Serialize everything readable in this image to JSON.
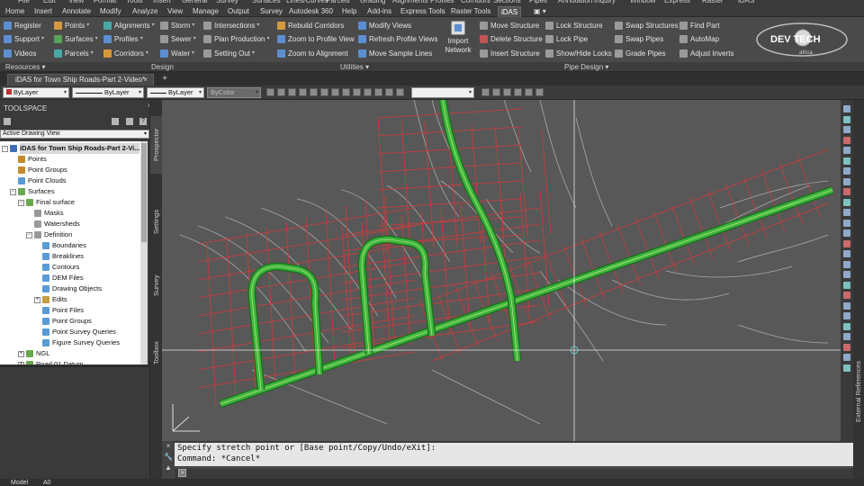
{
  "top_menu": [
    "File",
    "Edit",
    "View",
    "Format",
    "Tools",
    "Insert",
    "General",
    "Survey",
    "Surfaces",
    "Lines/Curves",
    "Parcels",
    "Grading",
    "Alignments",
    "Profiles",
    "Corridors",
    "Sections",
    "Pipes",
    "Annotation",
    "Inquiry",
    "Window",
    "Express",
    "Raster",
    "iDAS"
  ],
  "ribbon_tabs": [
    {
      "label": "Home"
    },
    {
      "label": "Insert"
    },
    {
      "label": "Annotate"
    },
    {
      "label": "Modify"
    },
    {
      "label": "Analyze"
    },
    {
      "label": "View"
    },
    {
      "label": "Manage"
    },
    {
      "label": "Output"
    },
    {
      "label": "Survey"
    },
    {
      "label": "Autodesk 360"
    },
    {
      "label": "Help"
    },
    {
      "label": "Add-ins"
    },
    {
      "label": "Express Tools"
    },
    {
      "label": "Raster Tools"
    },
    {
      "label": "iDAS",
      "active": true
    },
    {
      "label": "▣ ▾"
    }
  ],
  "ribbon": {
    "resources": [
      "Register",
      "Support",
      "Videos"
    ],
    "design_col1": [
      "Points",
      "Surfaces",
      "Parcels"
    ],
    "design_col2": [
      "Alignments",
      "Profiles",
      "Corridors"
    ],
    "design_col3": [
      "Storm",
      "Sewer",
      "Water"
    ],
    "design_col4": [
      "Intersections",
      "Plan Production",
      "Setting Out"
    ],
    "utilities_col1": [
      "Rebuild Corridors",
      "Zoom to Profile View",
      "Zoom to Alignment"
    ],
    "utilities_col2": [
      "Modify Views",
      "Refresh Profile Views",
      "Move Sample Lines"
    ],
    "import_network": "Import Network",
    "pipe_col1": [
      "Move Structure",
      "Delete Structure",
      "Insert Structure"
    ],
    "pipe_col2": [
      "Lock Structure",
      "Lock Pipe",
      "Show/Hide Locks"
    ],
    "pipe_col3": [
      "Swap Structures",
      "Swap Pipes",
      "Grade Pipes"
    ],
    "pipe_col4": [
      "Find Part",
      "AutoMap",
      "Adjust Inverts"
    ],
    "panels": {
      "resources": "Resources",
      "design": "Design",
      "utilities": "Utilities",
      "pipe_design": "Pipe Design"
    },
    "logo_text": "DEV TECH",
    "logo_sub": "africa"
  },
  "file_tab": {
    "title": "iDAS for Town Ship Roads-Part 2-Video*",
    "close": "×",
    "new": "+"
  },
  "properties": {
    "layer": "ByLayer",
    "linetype": "ByLayer",
    "lineweight": "ByLayer",
    "color": "ByColor",
    "arrow": "▾"
  },
  "toolspace": {
    "title": "TOOLSPACE",
    "close": "×",
    "view_select": "Active Drawing View",
    "tree": [
      {
        "label": "iDAS for Town Ship Roads-Part 2-Vi...",
        "level": 0,
        "toggle": "−",
        "bold": true
      },
      {
        "label": "Points",
        "level": 1,
        "toggle": ""
      },
      {
        "label": "Point Groups",
        "level": 1,
        "toggle": ""
      },
      {
        "label": "Point Clouds",
        "level": 1,
        "toggle": ""
      },
      {
        "label": "Surfaces",
        "level": 1,
        "toggle": "−"
      },
      {
        "label": "Final surface",
        "level": 2,
        "toggle": "−"
      },
      {
        "label": "Masks",
        "level": 3,
        "toggle": ""
      },
      {
        "label": "Watersheds",
        "level": 3,
        "toggle": ""
      },
      {
        "label": "Definition",
        "level": 3,
        "toggle": "−"
      },
      {
        "label": "Boundaries",
        "level": 4,
        "toggle": ""
      },
      {
        "label": "Breaklines",
        "level": 4,
        "toggle": ""
      },
      {
        "label": "Contours",
        "level": 4,
        "toggle": ""
      },
      {
        "label": "DEM Files",
        "level": 4,
        "toggle": ""
      },
      {
        "label": "Drawing Objects",
        "level": 4,
        "toggle": ""
      },
      {
        "label": "Edits",
        "level": 4,
        "toggle": "+"
      },
      {
        "label": "Point Files",
        "level": 4,
        "toggle": ""
      },
      {
        "label": "Point Groups",
        "level": 4,
        "toggle": ""
      },
      {
        "label": "Point Survey Queries",
        "level": 4,
        "toggle": ""
      },
      {
        "label": "Figure Survey Queries",
        "level": 4,
        "toggle": ""
      },
      {
        "label": "NGL",
        "level": 2,
        "toggle": "+"
      },
      {
        "label": "Road 01 Datum",
        "level": 2,
        "toggle": "+"
      }
    ],
    "side_tabs": [
      "Prospector",
      "Settings",
      "Survey",
      "Toolbox"
    ]
  },
  "command": {
    "history": [
      "Specify stretch point or [Base point/Copy/Undo/eXit]:",
      "Command: *Cancel*"
    ],
    "controls": [
      "×",
      "🔧",
      "▲"
    ]
  },
  "right_panel": {
    "external_references": "External References"
  },
  "layout_tabs": [
    "Model",
    "A0"
  ],
  "colors": {
    "road": "#3cb93c",
    "parcel": "#d23a3a",
    "contour": "#a9a9a9",
    "canvas": "#585858"
  }
}
